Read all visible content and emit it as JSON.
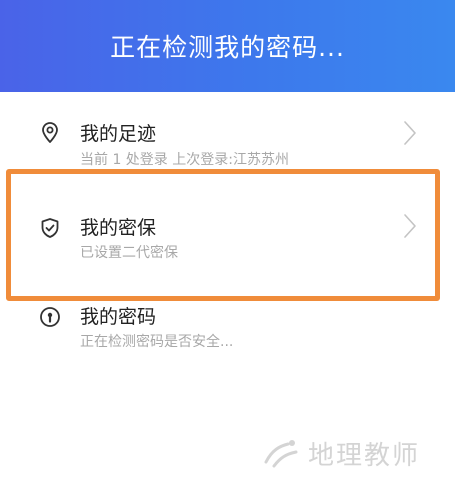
{
  "header": {
    "title": "正在检测我的密码..."
  },
  "items": [
    {
      "title": "我的足迹",
      "subtitle": "当前 1 处登录 上次登录:江苏苏州",
      "icon": "location-pin-icon",
      "has_chevron": true
    },
    {
      "title": "我的密保",
      "subtitle": "已设置二代密保",
      "icon": "shield-check-icon",
      "has_chevron": true
    },
    {
      "title": "我的密码",
      "subtitle": "正在检测密码是否安全...",
      "icon": "keyhole-icon",
      "has_chevron": false
    }
  ],
  "watermark": {
    "text": "地理教师"
  },
  "colors": {
    "header_start": "#4a63e8",
    "header_end": "#3a88ef",
    "highlight": "#f08c3a",
    "title_text": "#222222",
    "subtitle_text": "#a8a8a8"
  }
}
